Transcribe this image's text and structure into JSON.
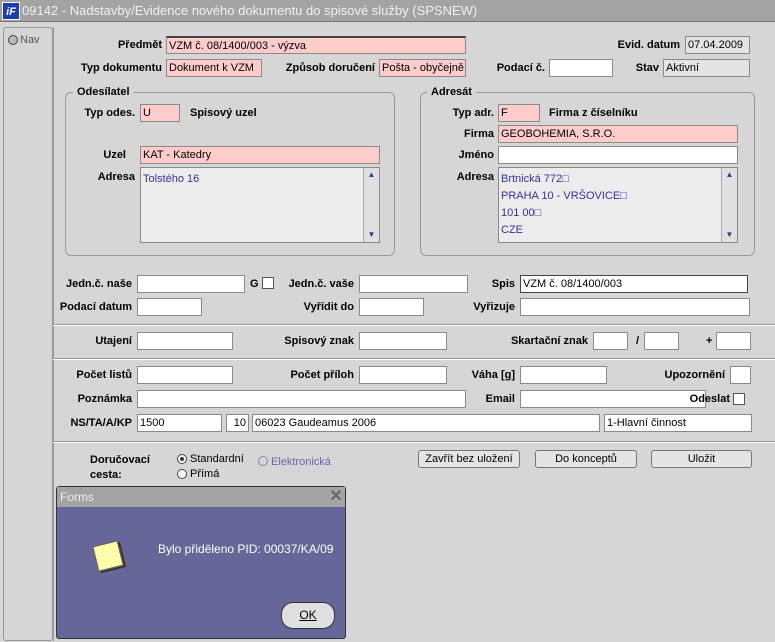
{
  "window": {
    "title": "09142 - Nadstavby/Evidence nového dokumentu do spisové služby (SPSNEW)",
    "logo": "iF"
  },
  "nav": {
    "label": "Nav"
  },
  "header": {
    "predmet_label": "Předmět",
    "predmet": "VZM č. 08/1400/003 - výzva",
    "evid_datum_label": "Evid. datum",
    "evid_datum": "07.04.2009",
    "typ_dokumentu_label": "Typ dokumentu",
    "typ_dokumentu": "Dokument k VZM",
    "zpusob_doruceni_label": "Způsob doručení",
    "zpusob_doruceni": "Pošta - obyčejně",
    "podaci_c_label": "Podací č.",
    "podaci_c": "",
    "stav_label": "Stav",
    "stav": "Aktivní"
  },
  "odesilatel": {
    "title": "Odesílatel",
    "typ_label": "Typ odes.",
    "typ": "U",
    "typ_text": "Spisový uzel",
    "uzel_label": "Uzel",
    "uzel": "KAT - Katedry",
    "adresa_label": "Adresa",
    "adresa": "Tolstého 16"
  },
  "adresat": {
    "title": "Adresát",
    "typ_label": "Typ adr.",
    "typ": "F",
    "typ_text": "Firma z číselníku",
    "firma_label": "Firma",
    "firma": "GEOBOHEMIA, S.R.O.",
    "jmeno_label": "Jméno",
    "jmeno": "",
    "adresa_label": "Adresa",
    "adresa_lines": [
      "Brtnická 772□",
      "PRAHA 10 - VRŠOVICE□",
      "101 00□",
      "CZE"
    ]
  },
  "details": {
    "jedn_nase_label": "Jedn.č. naše",
    "g_label": "G",
    "jedn_vase_label": "Jedn.č. vaše",
    "spis_label": "Spis",
    "spis": "VZM č. 08/1400/003",
    "podaci_datum_label": "Podací datum",
    "vyridit_do_label": "Vyřídit do",
    "vyrizuje_label": "Vyřizuje",
    "utajeni_label": "Utajení",
    "spisovy_znak_label": "Spisový znak",
    "skartacni_znak_label": "Skartační znak",
    "slash": "/",
    "plus": "+",
    "pocet_listu_label": "Počet listů",
    "pocet_priloh_label": "Počet příloh",
    "vaha_label": "Váha [g]",
    "upozorneni_label": "Upozornění",
    "poznamka_label": "Poznámka",
    "email_label": "Email",
    "odeslat_label": "Odeslat",
    "ns_label": "NS/TA/A/KP",
    "ns": "1500",
    "ta": "10",
    "a": "06023 Gaudeamus 2006",
    "kp": "1-Hlavní činnost"
  },
  "delivery": {
    "label1": "Doručovací",
    "label2": "cesta:",
    "options": [
      "Standardní",
      "Elektronická",
      "Přímá"
    ],
    "selected": "Standardní"
  },
  "buttons": {
    "close": "Zavřít bez uložení",
    "draft": "Do konceptů",
    "save": "Uložit"
  },
  "dialog": {
    "title": "Forms",
    "message": "Bylo přiděleno PID: 00037/KA/09",
    "ok": "OK"
  }
}
